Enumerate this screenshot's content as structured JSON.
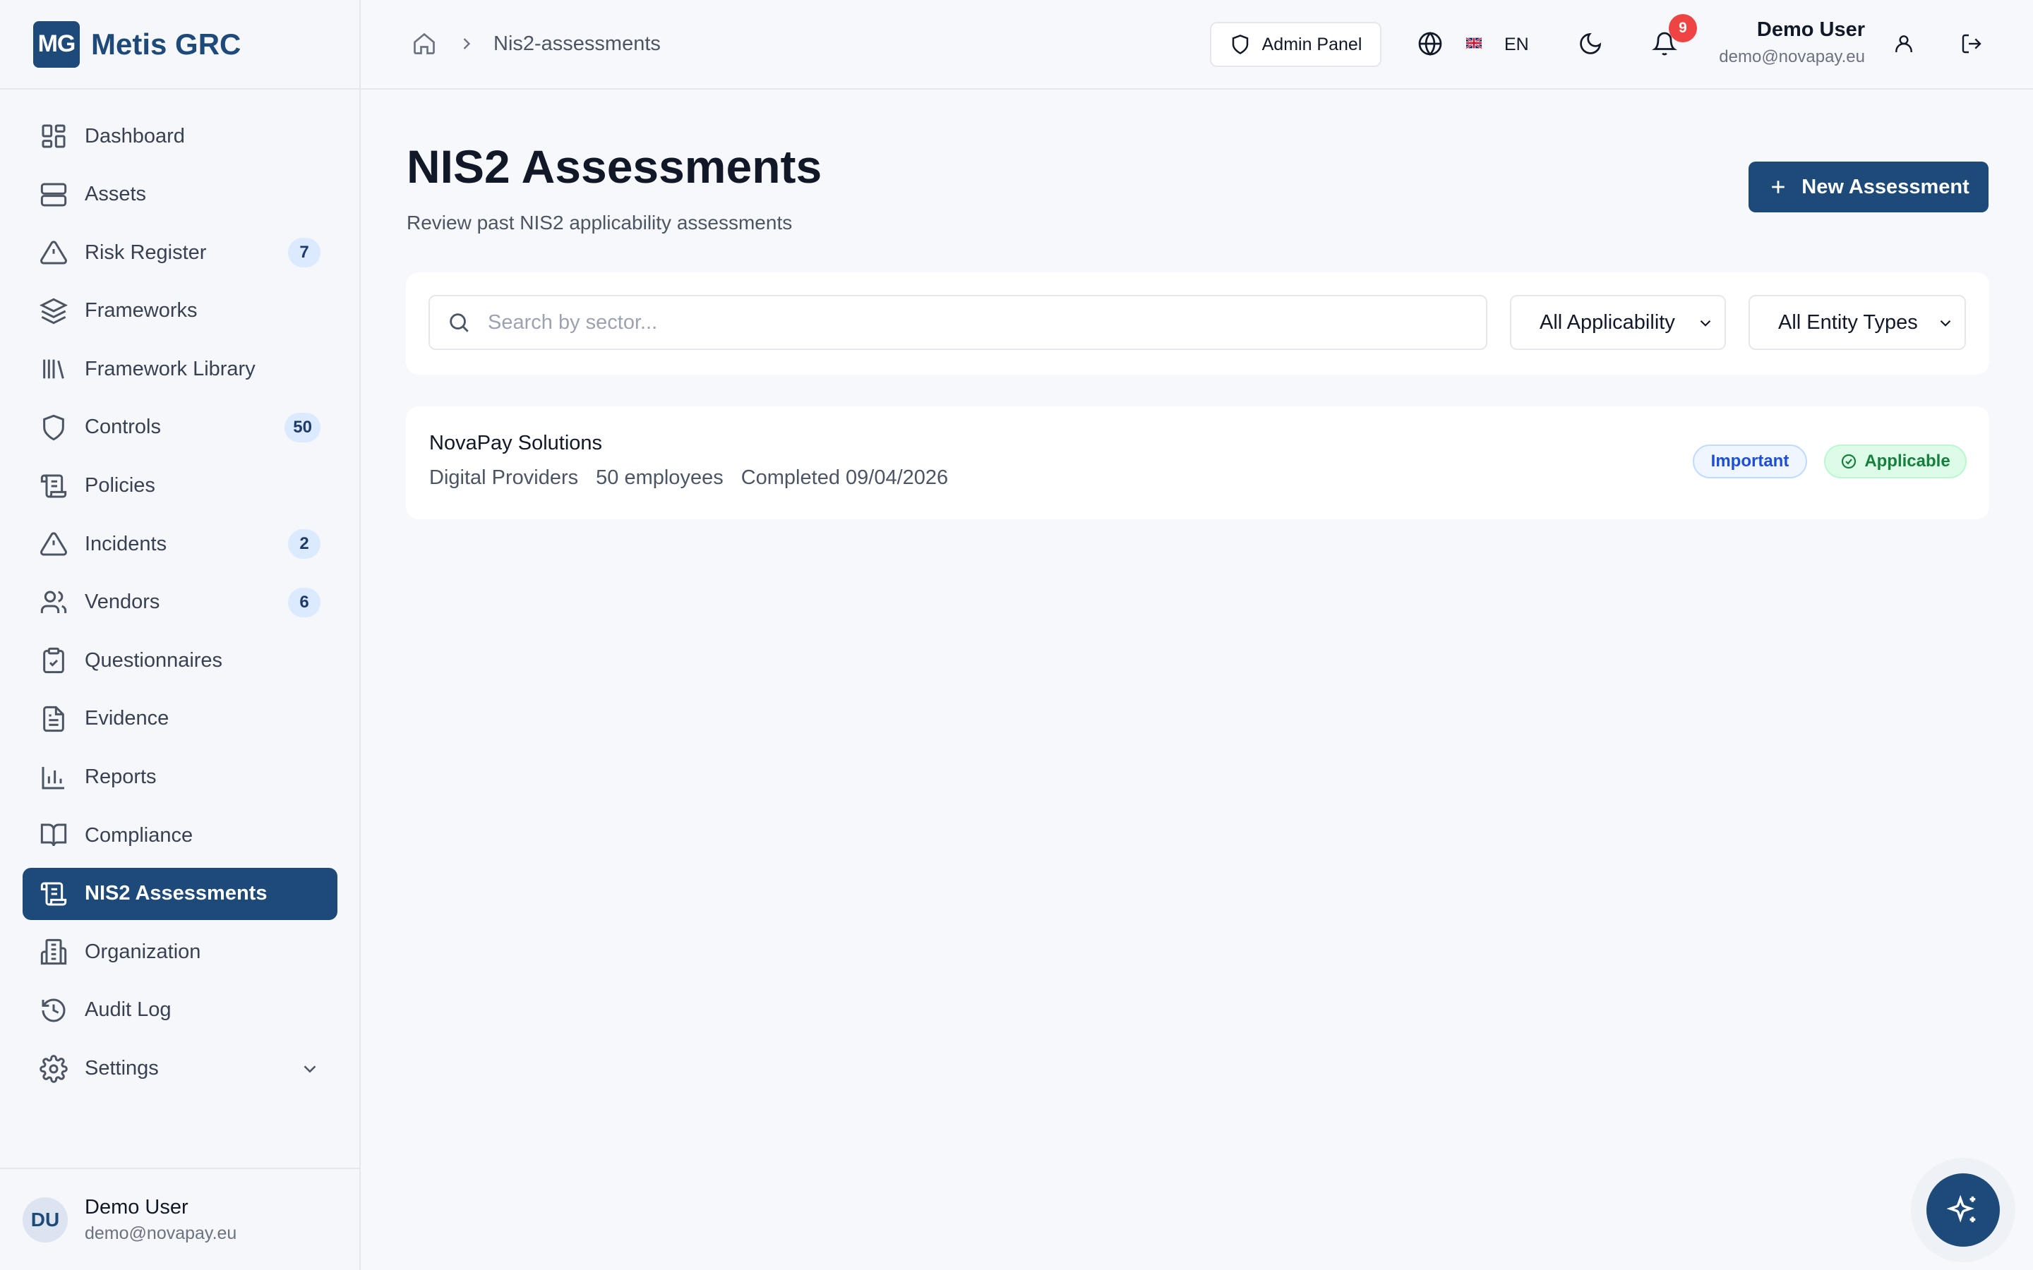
{
  "brand": {
    "logo_text": "MG",
    "name": "Metis GRC",
    "color": "#1e4a7a"
  },
  "sidebar": {
    "items": [
      {
        "label": "Dashboard",
        "icon": "layout-grid-icon"
      },
      {
        "label": "Assets",
        "icon": "server-icon"
      },
      {
        "label": "Risk Register",
        "icon": "warning-triangle-icon",
        "badge": "7"
      },
      {
        "label": "Frameworks",
        "icon": "layers-icon"
      },
      {
        "label": "Framework Library",
        "icon": "library-icon"
      },
      {
        "label": "Controls",
        "icon": "shield-icon",
        "badge": "50"
      },
      {
        "label": "Policies",
        "icon": "scroll-icon"
      },
      {
        "label": "Incidents",
        "icon": "warning-triangle-icon",
        "badge": "2"
      },
      {
        "label": "Vendors",
        "icon": "users-icon",
        "badge": "6"
      },
      {
        "label": "Questionnaires",
        "icon": "clipboard-check-icon"
      },
      {
        "label": "Evidence",
        "icon": "file-text-icon"
      },
      {
        "label": "Reports",
        "icon": "bar-chart-icon"
      },
      {
        "label": "Compliance",
        "icon": "book-open-icon"
      },
      {
        "label": "NIS2 Assessments",
        "icon": "scroll-icon",
        "active": true
      },
      {
        "label": "Organization",
        "icon": "building-icon"
      },
      {
        "label": "Audit Log",
        "icon": "history-icon"
      },
      {
        "label": "Settings",
        "icon": "gear-icon"
      }
    ],
    "user": {
      "initials": "DU",
      "name": "Demo User",
      "email": "demo@novapay.eu"
    }
  },
  "header": {
    "breadcrumb": "Nis2-assessments",
    "admin_label": "Admin Panel",
    "language": "EN",
    "notification_count": "9",
    "user_name": "Demo User",
    "user_email": "demo@novapay.eu"
  },
  "main": {
    "title": "NIS2 Assessments",
    "subtitle": "Review past NIS2 applicability assessments",
    "new_button": "New Assessment",
    "search_placeholder": "Search by sector...",
    "filter_applicability": "All Applicability",
    "filter_entity": "All Entity Types",
    "assessments": [
      {
        "name": "NovaPay Solutions",
        "sector": "Digital Providers",
        "employees": "50 employees",
        "completed": "Completed 09/04/2026",
        "classification": "Important",
        "status": "Applicable"
      }
    ]
  },
  "colors": {
    "accent": "#1e4a7a",
    "badge_bg": "#dbeafe",
    "notification": "#ef4444",
    "success": "#15803d"
  }
}
